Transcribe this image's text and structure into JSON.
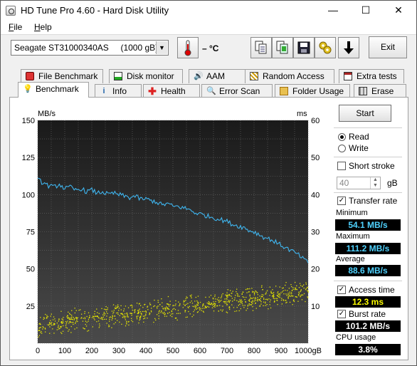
{
  "window": {
    "title": "HD Tune Pro 4.60 - Hard Disk Utility",
    "controls": {
      "minimize": "—",
      "maximize": "☐",
      "close": "✕"
    }
  },
  "menu": [
    {
      "label": "File",
      "accel": "F"
    },
    {
      "label": "Help",
      "accel": "H"
    }
  ],
  "toolbar": {
    "drive": "Seagate ST31000340AS     (1000 gB)",
    "temperature": "– °C",
    "exit_label": "Exit",
    "icons": [
      "copy-text-icon",
      "copy-screenshot-icon",
      "save-icon",
      "options-icon",
      "down-arrow-icon"
    ]
  },
  "tabs_top": [
    "File Benchmark",
    "Disk monitor",
    "AAM",
    "Random Access",
    "Extra tests"
  ],
  "tabs_bottom": [
    "Benchmark",
    "Info",
    "Health",
    "Error Scan",
    "Folder Usage",
    "Erase"
  ],
  "active_tab": "Benchmark",
  "controls": {
    "start_label": "Start",
    "read_label": "Read",
    "write_label": "Write",
    "mode": "Read",
    "short_stroke_label": "Short stroke",
    "short_stroke_checked": false,
    "short_stroke_value": "40",
    "short_stroke_unit": "gB",
    "transfer_rate_label": "Transfer rate",
    "transfer_rate_checked": true,
    "access_time_label": "Access time",
    "access_time_checked": true,
    "burst_rate_label": "Burst rate",
    "burst_rate_checked": true,
    "check_mark": "✓"
  },
  "results": {
    "minimum_label": "Minimum",
    "minimum": "54.1 MB/s",
    "maximum_label": "Maximum",
    "maximum": "111.2 MB/s",
    "average_label": "Average",
    "average": "88.6 MB/s",
    "access_time": "12.3 ms",
    "burst_rate": "101.2 MB/s",
    "cpu_label": "CPU usage",
    "cpu_usage": "3.8%"
  },
  "colors": {
    "transfer_line": "#3fb6f0",
    "access_dots": "#e6e600",
    "plot_bg_top": "#1a1a1a",
    "plot_bg_bottom": "#4a4a4a",
    "stat_text_blue": "#4fd2ff",
    "stat_text_yellow": "#ffff00",
    "stat_text_white": "#ffffff"
  },
  "chart_data": {
    "type": "line",
    "y_left_label": "MB/s",
    "y_right_label": "ms",
    "x_unit": "gB",
    "xlim": [
      0,
      1000
    ],
    "ylim_left": [
      0,
      150
    ],
    "ylim_right": [
      0,
      60
    ],
    "x_ticks": [
      0,
      100,
      200,
      300,
      400,
      500,
      600,
      700,
      800,
      900,
      1000
    ],
    "y_left_ticks": [
      25,
      50,
      75,
      100,
      125,
      150
    ],
    "y_right_ticks": [
      10,
      20,
      30,
      40,
      50,
      60
    ],
    "grid": true,
    "series": [
      {
        "name": "Transfer rate",
        "axis": "left",
        "x": [
          0,
          20,
          40,
          60,
          80,
          100,
          120,
          140,
          160,
          180,
          200,
          220,
          240,
          260,
          280,
          300,
          320,
          340,
          360,
          380,
          400,
          420,
          440,
          460,
          480,
          500,
          520,
          540,
          560,
          580,
          600,
          620,
          640,
          660,
          680,
          700,
          720,
          740,
          760,
          780,
          800,
          820,
          840,
          860,
          880,
          900,
          920,
          940,
          960,
          980,
          1000
        ],
        "y": [
          110,
          108,
          106,
          105,
          107,
          104,
          105,
          103,
          104,
          102,
          103,
          101,
          102,
          100,
          101,
          100,
          99,
          98,
          99,
          97,
          97,
          96,
          95,
          93,
          94,
          92,
          92,
          91,
          90,
          88,
          87,
          86,
          85,
          84,
          83,
          82,
          80,
          79,
          78,
          76,
          75,
          73,
          71,
          70,
          68,
          66,
          64,
          62,
          60,
          57,
          54
        ]
      },
      {
        "name": "Access time",
        "axis": "right",
        "type": "scatter",
        "trend": {
          "x": [
            0,
            1000
          ],
          "y": [
            5,
            14
          ]
        },
        "spread": 3.5,
        "count": 900
      }
    ]
  }
}
